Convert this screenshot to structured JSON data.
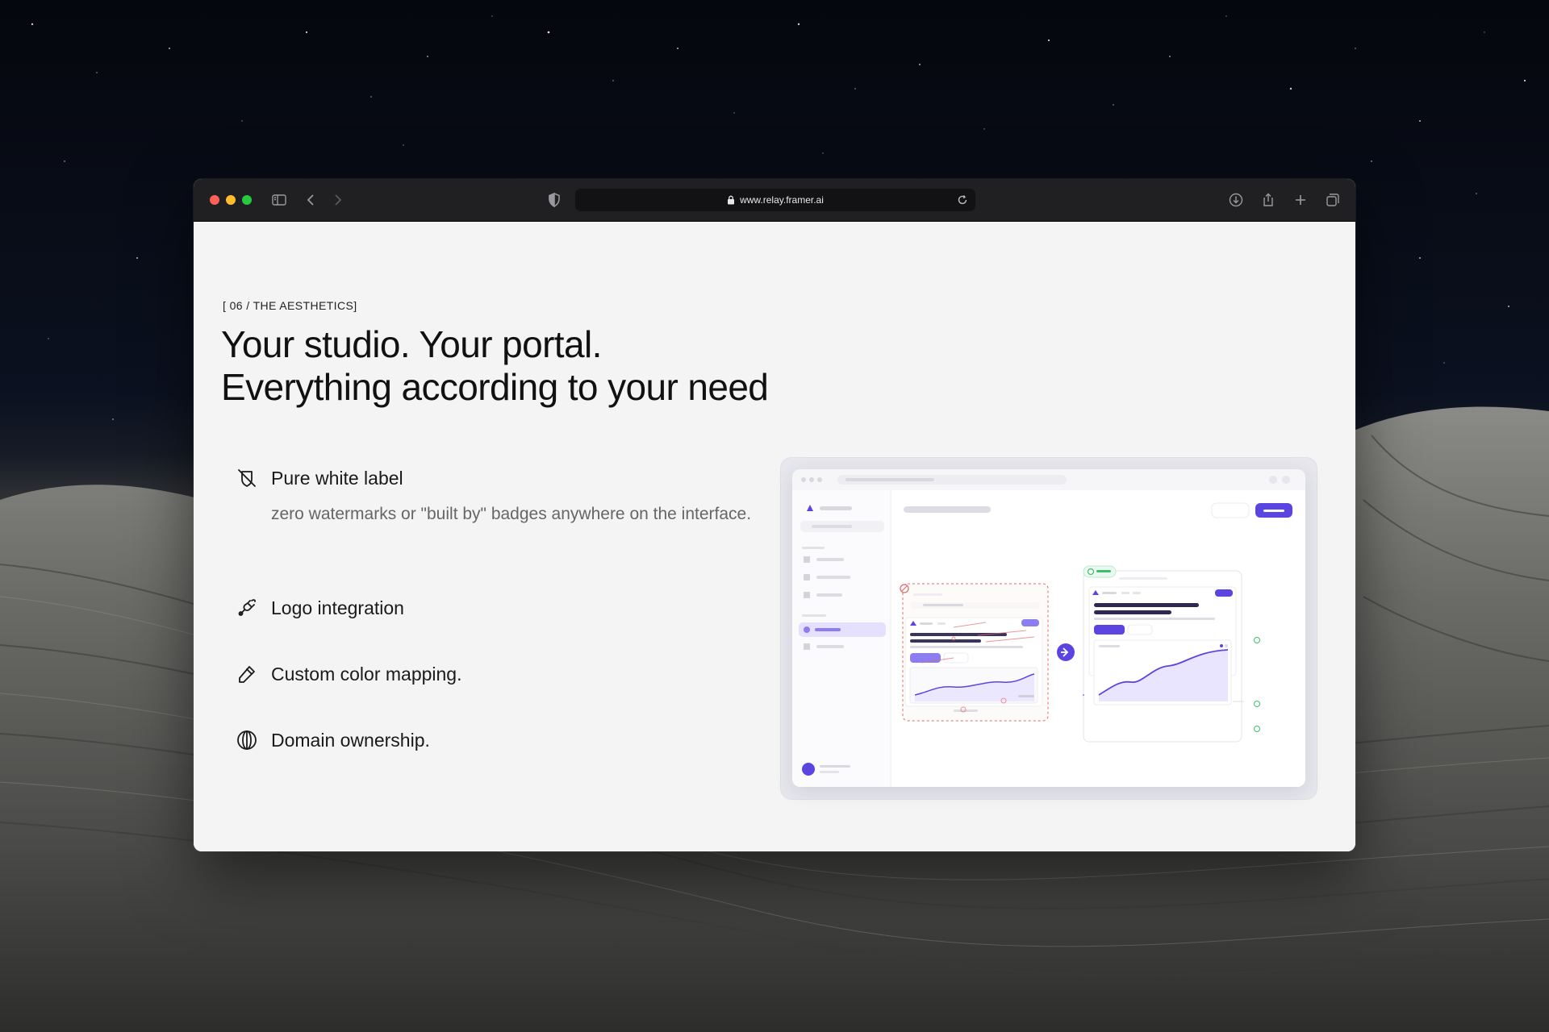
{
  "browser": {
    "url": "www.relay.framer.ai"
  },
  "section": {
    "eyebrow": "[ 06 / THE AESTHETICS]",
    "headline_line1": "Your studio. Your portal.",
    "headline_line2": "Everything according to your need"
  },
  "features": [
    {
      "icon": "no-badge-icon",
      "title": "Pure white label",
      "description": "zero watermarks or \"built by\" badges anywhere on the interface."
    },
    {
      "icon": "plug-icon",
      "title": "Logo integration"
    },
    {
      "icon": "eyedropper-icon",
      "title": "Custom color mapping."
    },
    {
      "icon": "globe-icon",
      "title": "Domain ownership."
    }
  ],
  "colors": {
    "accent": "#5b45e0",
    "accent_light": "#e6e0ff",
    "dashed_border": "#e46b6b",
    "page_bg": "#f4f4f4"
  }
}
